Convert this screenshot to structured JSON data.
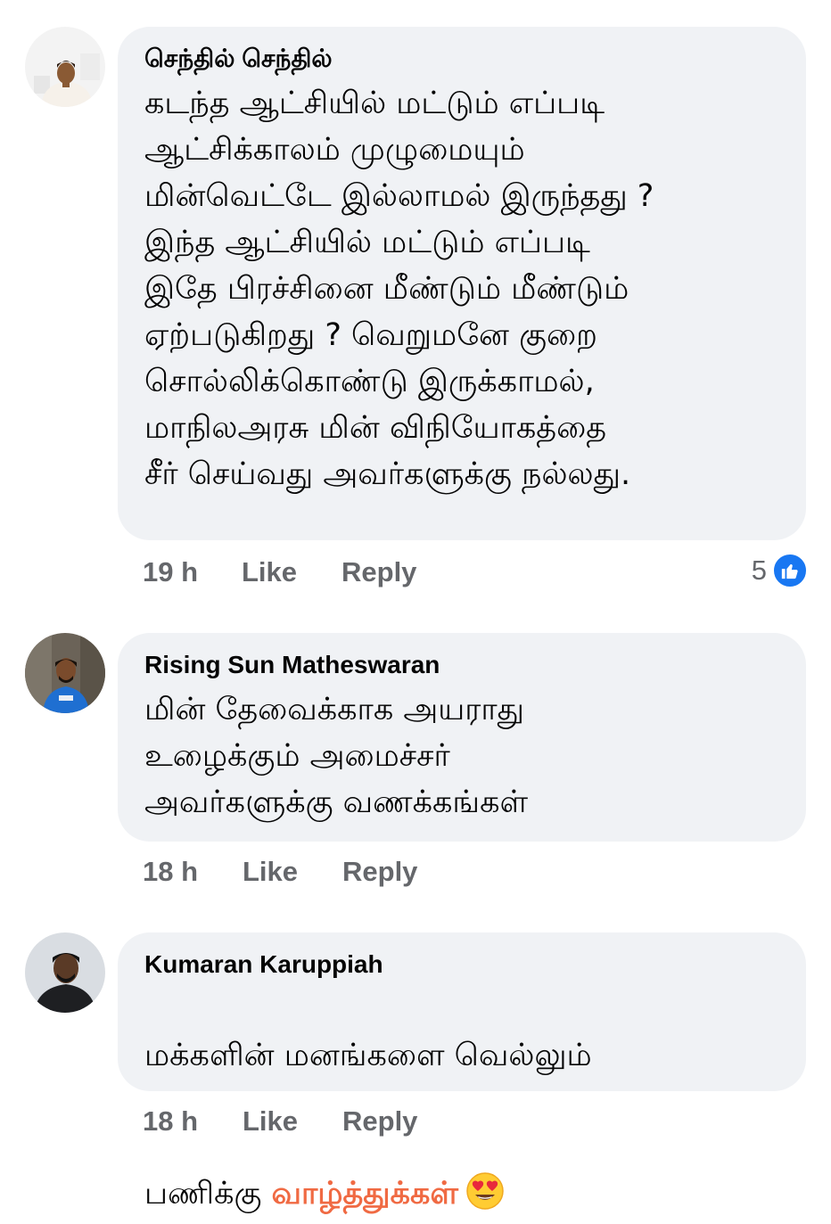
{
  "comments": [
    {
      "author": "செந்தில் செந்தில்",
      "text": "கடந்த ஆட்சியில் மட்டும் எப்படி\nஆட்சிக்காலம் முழுமையும்\nமின்வெட்டே இல்லாமல் இருந்தது ?\nஇந்த ஆட்சியில் மட்டும் எப்படி\nஇதே பிரச்சினை மீண்டும் மீண்டும்\nஏற்படுகிறது ? வெறுமனே குறை\nசொல்லிக்கொண்டு இருக்காமல்,\nமாநிலஅரசு மின் விநியோகத்தை\nசீர் செய்வது அவர்களுக்கு நல்லது.",
      "time": "19 h",
      "like_label": "Like",
      "reply_label": "Reply",
      "reaction_count": "5",
      "avatar_icon": "person-avatar-icon"
    },
    {
      "author": "Rising Sun Matheswaran",
      "text": "மின் தேவைக்காக அயராது\nஉழைக்கும் அமைச்சர்\nஅவர்களுக்கு வணக்கங்கள்",
      "time": "18 h",
      "like_label": "Like",
      "reply_label": "Reply",
      "avatar_icon": "person-avatar-icon"
    },
    {
      "author": "Kumaran Karuppiah",
      "text_line1": "மக்களின் மனங்களை வெல்லும்",
      "text_line2_prefix": "பணிக்கு ",
      "text_highlight": "வாழ்த்துக்கள்",
      "emoji": "heart-eyes-emoji-icon",
      "time": "18 h",
      "like_label": "Like",
      "reply_label": "Reply",
      "avatar_icon": "person-avatar-icon"
    }
  ],
  "colors": {
    "bubble": "#f0f2f5",
    "meta": "#65676b",
    "like_blue": "#1877f2",
    "highlight": "#f06a43"
  }
}
